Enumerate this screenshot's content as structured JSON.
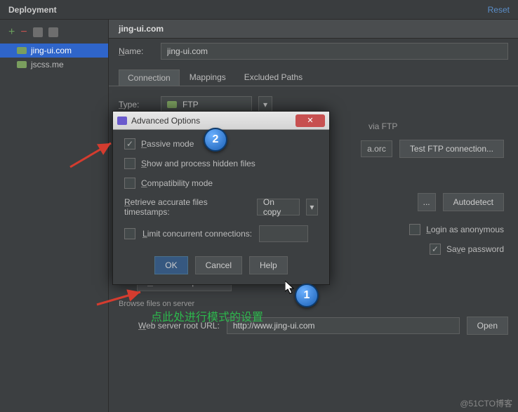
{
  "topbar": {
    "title": "Deployment",
    "reset": "Reset"
  },
  "sidebar": {
    "items": [
      {
        "label": "jing-ui.com"
      },
      {
        "label": "jscss.me"
      }
    ]
  },
  "header": {
    "title": "jing-ui.com"
  },
  "form": {
    "name_label": "Name:",
    "name_value": "jing-ui.com",
    "type_label": "Type:",
    "type_value": "FTP",
    "via_text": "via FTP",
    "host_suffix": "a.orc",
    "test_ftp": "Test FTP connection...",
    "browse_btn": "...",
    "autodetect": "Autodetect",
    "login_anon": "Login as anonymous",
    "save_password": "Save password",
    "advanced": "Advanced options...",
    "browse_label": "Browse files on server",
    "web_root_label": "Web server root URL:",
    "web_root_value": "http://www.jing-ui.com",
    "open_btn": "Open"
  },
  "tabs": [
    {
      "label": "Connection"
    },
    {
      "label": "Mappings"
    },
    {
      "label": "Excluded Paths"
    }
  ],
  "dialog": {
    "title": "Advanced Options",
    "passive": "Passive mode",
    "show_hidden": "Show and process hidden files",
    "compat": "Compatibility mode",
    "retrieve": "Retrieve accurate files timestamps:",
    "retrieve_value": "On copy",
    "limit": "Limit concurrent connections:",
    "ok": "OK",
    "cancel": "Cancel",
    "help": "Help"
  },
  "annotation": {
    "bubble1": "1",
    "bubble2": "2",
    "green": "点此处进行模式的设置"
  },
  "watermark": "@51CTO博客"
}
